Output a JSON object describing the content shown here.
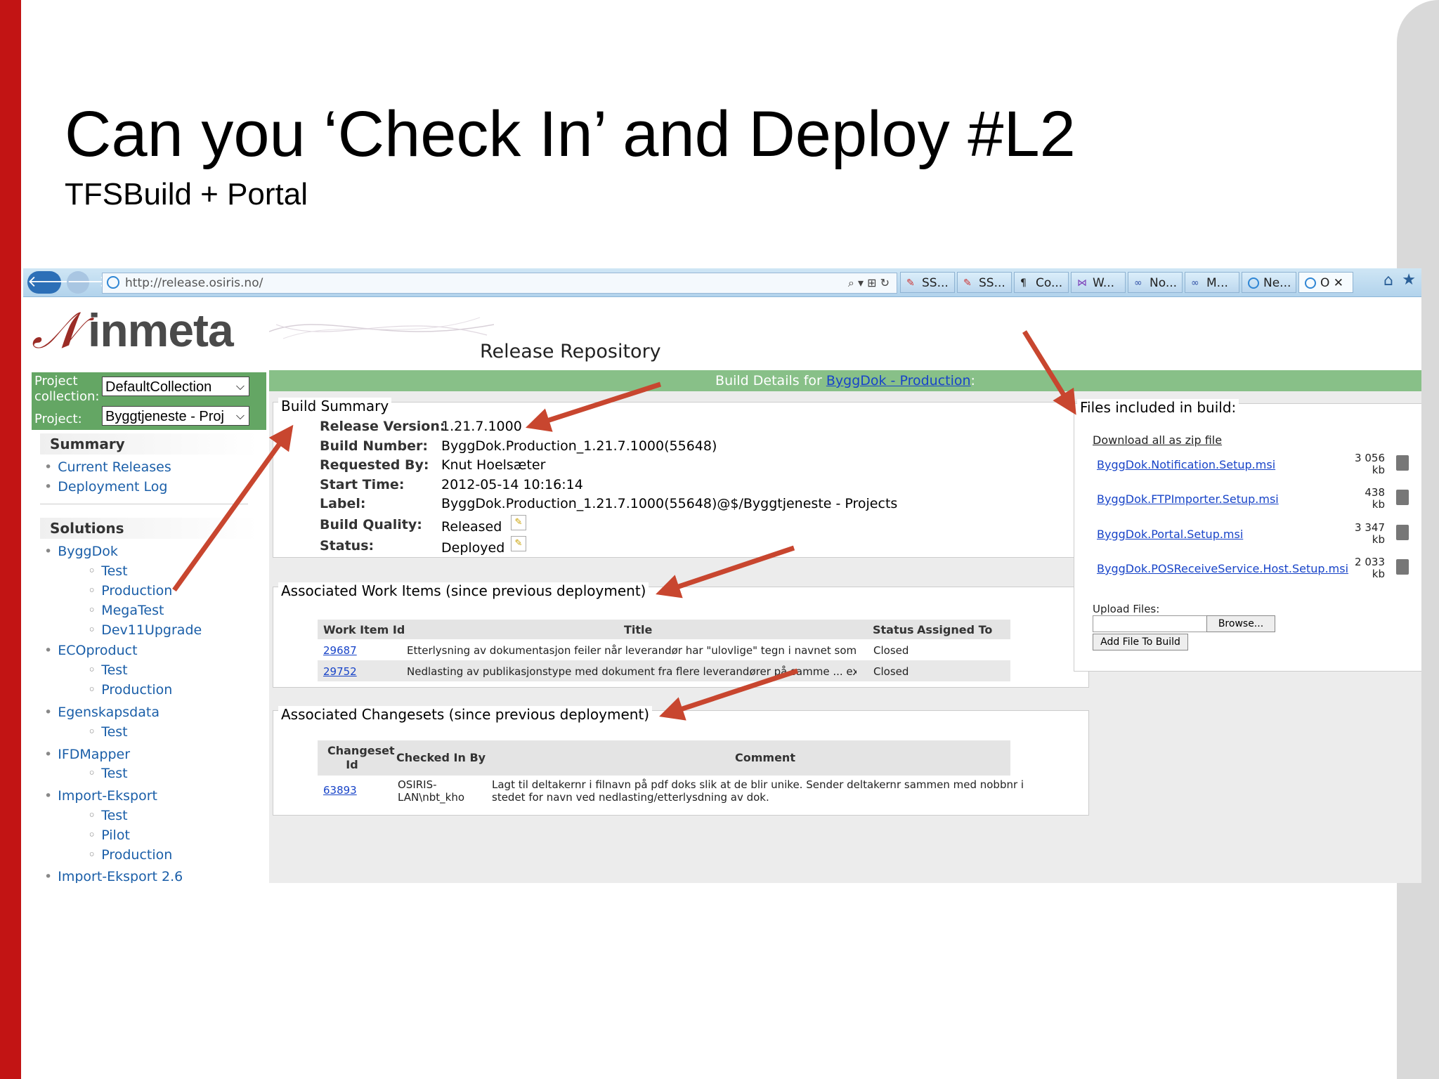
{
  "slide": {
    "title": "Can you ‘Check In’ and Deploy #L2",
    "subtitle": "TFSBuild + Portal"
  },
  "browser": {
    "url": "http://release.osiris.no/",
    "tabs": [
      "SS...",
      "SS...",
      "Co...",
      "W...",
      "No...",
      "M...",
      "Ne...",
      "O"
    ]
  },
  "brand": {
    "logo_text": "inmeta",
    "logo_mark": "𝒩"
  },
  "page": {
    "title": "Release Repository",
    "header_prefix": "Build Details for ",
    "header_link": "ByggDok - Production",
    "header_suffix": ":"
  },
  "selectors": {
    "collection_label_1": "Project",
    "collection_label_2": "collection:",
    "collection_value": "DefaultCollection",
    "project_label": "Project:",
    "project_value": "Byggtjeneste - Proj"
  },
  "nav": {
    "summary_heading": "Summary",
    "summary_links": [
      "Current Releases",
      "Deployment Log"
    ],
    "solutions_heading": "Solutions",
    "solutions": [
      {
        "name": "ByggDok",
        "children": [
          "Test",
          "Production",
          "MegaTest",
          "Dev11Upgrade"
        ]
      },
      {
        "name": "ECOproduct",
        "children": [
          "Test",
          "Production"
        ]
      },
      {
        "name": "Egenskapsdata",
        "children": [
          "Test"
        ]
      },
      {
        "name": "IFDMapper",
        "children": [
          "Test"
        ]
      },
      {
        "name": "Import-Eksport",
        "children": [
          "Test",
          "Pilot",
          "Production"
        ]
      },
      {
        "name": "Import-Eksport 2.6",
        "children": []
      }
    ]
  },
  "build_summary": {
    "heading": "Build Summary",
    "rows": [
      {
        "label": "Release Version:",
        "value": "1.21.7.1000"
      },
      {
        "label": "Build Number:",
        "value": "ByggDok.Production_1.21.7.1000(55648)"
      },
      {
        "label": "Requested By:",
        "value": "Knut Hoelsæter"
      },
      {
        "label": "Start Time:",
        "value": "2012-05-14 10:16:14"
      },
      {
        "label": "Label:",
        "value": "ByggDok.Production_1.21.7.1000(55648)@$/Byggtjeneste - Projects"
      },
      {
        "label": "Build Quality:",
        "value": "Released"
      },
      {
        "label": "Status:",
        "value": "Deployed"
      }
    ]
  },
  "work_items": {
    "heading": "Associated Work Items (since previous deployment)",
    "columns": [
      "Work Item Id",
      "Title",
      "Status",
      "Assigned To"
    ],
    "rows": [
      {
        "id": "29687",
        "title": "Etterlysning av dokumentasjon feiler når leverandør har \"ulovlige\" tegn i navnet som feks &",
        "status": "Closed",
        "assigned": ""
      },
      {
        "id": "29752",
        "title": "Nedlasting av publikasjonstype med dokument fra flere leverandører på samme ... exception",
        "status": "Closed",
        "assigned": ""
      }
    ]
  },
  "changesets": {
    "heading": "Associated Changesets (since previous deployment)",
    "columns": [
      "Changeset Id",
      "Checked In By",
      "Comment"
    ],
    "rows": [
      {
        "id": "63893",
        "by_1": "OSIRIS-",
        "by_2": "LAN\\nbt_kho",
        "comment_1": "Lagt til deltakernr i filnavn på pdf doks slik at de blir unike. Sender deltakernr sammen med nobbnr i",
        "comment_2": "stedet for navn ved nedlasting/etterlysdning av dok."
      }
    ]
  },
  "files": {
    "heading": "Files included in build:",
    "download_all": "Download all as zip file",
    "items": [
      {
        "name": "ByggDok.Notification.Setup.msi",
        "size": "3 056",
        "unit": "kb"
      },
      {
        "name": "ByggDok.FTPImporter.Setup.msi",
        "size": "438",
        "unit": "kb"
      },
      {
        "name": "ByggDok.Portal.Setup.msi",
        "size": "3 347",
        "unit": "kb"
      },
      {
        "name": "ByggDok.POSReceiveService.Host.Setup.msi",
        "size": "2 033",
        "unit": "kb"
      }
    ],
    "upload_label": "Upload Files:",
    "browse_label": "Browse...",
    "add_label": "Add File To Build"
  },
  "colors": {
    "accent_red": "#c21414",
    "green_header": "#88c088",
    "link_blue": "#1844c8",
    "arrow": "#c8462f"
  }
}
